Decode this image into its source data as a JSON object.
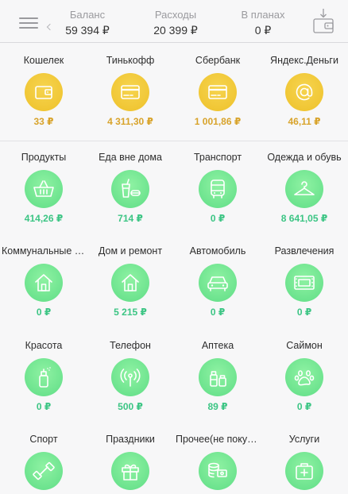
{
  "header": {
    "stats": [
      {
        "label": "Баланс",
        "value": "59 394 ₽"
      },
      {
        "label": "Расходы",
        "value": "20 399 ₽"
      },
      {
        "label": "В планах",
        "value": "0 ₽"
      }
    ],
    "menu_icon": "hamburger-icon",
    "wallet_icon": "wallet-download-icon"
  },
  "accounts": [
    {
      "name": "Кошелек",
      "amount": "33 ₽",
      "icon": "wallet-icon"
    },
    {
      "name": "Тинькофф",
      "amount": "4 311,30 ₽",
      "icon": "card-icon"
    },
    {
      "name": "Сбербанк",
      "amount": "1 001,86 ₽",
      "icon": "card-icon"
    },
    {
      "name": "Яндекс.Деньги",
      "amount": "46,11 ₽",
      "icon": "at-sign-icon"
    }
  ],
  "categories": [
    {
      "name": "Продукты",
      "amount": "414,26 ₽",
      "icon": "basket-icon"
    },
    {
      "name": "Еда вне дома",
      "amount": "714 ₽",
      "icon": "food-icon"
    },
    {
      "name": "Транспорт",
      "amount": "0 ₽",
      "icon": "bus-icon"
    },
    {
      "name": "Одежда и обувь",
      "amount": "8 641,05 ₽",
      "icon": "hanger-icon"
    },
    {
      "name": "Коммунальные у...",
      "amount": "0 ₽",
      "icon": "house-icon"
    },
    {
      "name": "Дом и ремонт",
      "amount": "5 215 ₽",
      "icon": "house-icon"
    },
    {
      "name": "Автомобиль",
      "amount": "0 ₽",
      "icon": "car-icon"
    },
    {
      "name": "Развлечения",
      "amount": "0 ₽",
      "icon": "film-icon"
    },
    {
      "name": "Красота",
      "amount": "0 ₽",
      "icon": "spray-bottle-icon"
    },
    {
      "name": "Телефон",
      "amount": "500 ₽",
      "icon": "antenna-icon"
    },
    {
      "name": "Аптека",
      "amount": "89 ₽",
      "icon": "medicine-icon"
    },
    {
      "name": "Саймон",
      "amount": "0 ₽",
      "icon": "paw-icon"
    },
    {
      "name": "Спорт",
      "amount": "",
      "icon": "dumbbell-icon"
    },
    {
      "name": "Праздники",
      "amount": "",
      "icon": "gift-icon"
    },
    {
      "name": "Прочее(не покуп...",
      "amount": "",
      "icon": "coins-icon"
    },
    {
      "name": "Услуги",
      "amount": "",
      "icon": "first-aid-icon"
    }
  ],
  "colors": {
    "account_circle": "#efc52e",
    "account_amount": "#d8a32a",
    "category_circle": "#6be392",
    "category_amount": "#3cc584"
  }
}
